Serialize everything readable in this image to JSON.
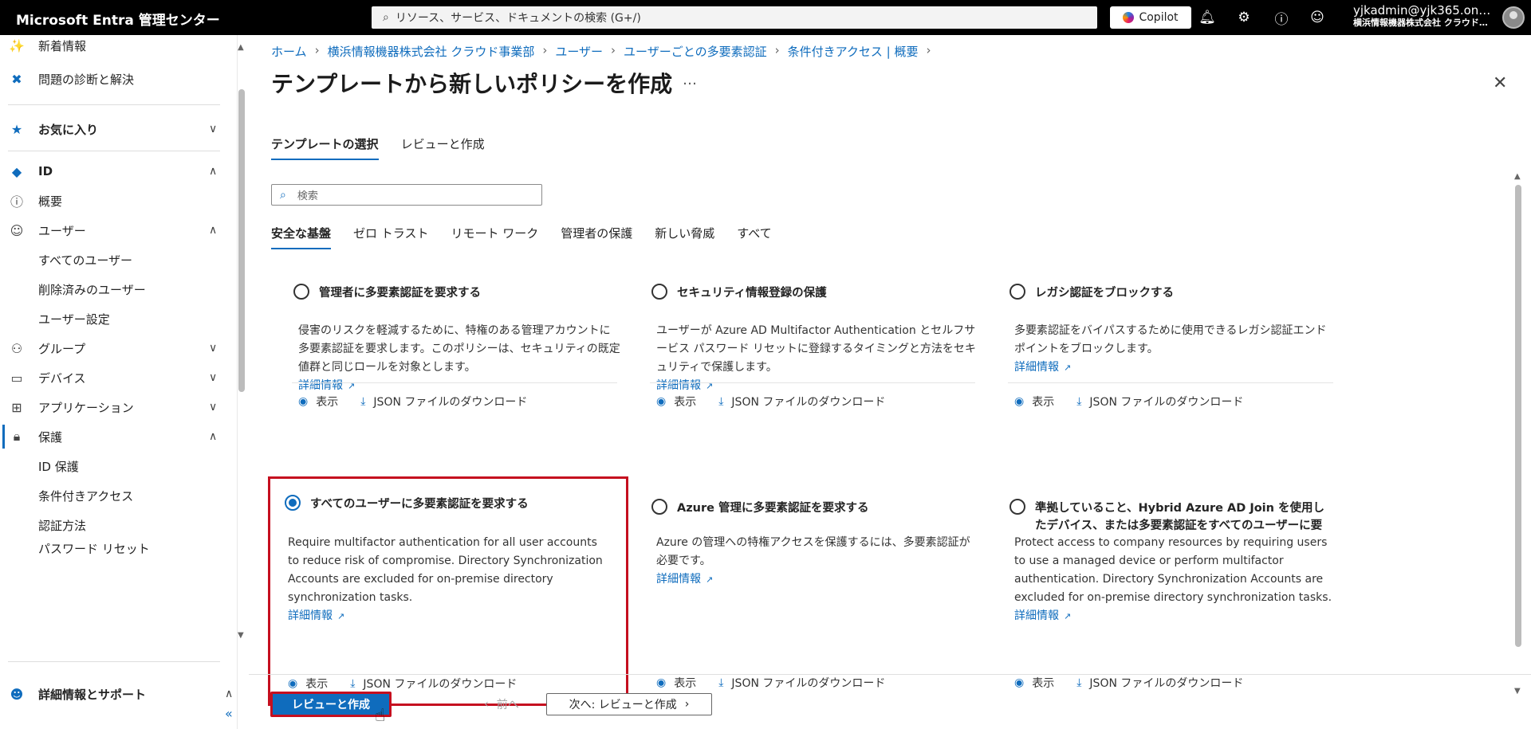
{
  "topbar": {
    "brand": "Microsoft Entra 管理センター",
    "search_placeholder": "リソース、サービス、ドキュメントの検索 (G+/)",
    "copilot_label": "Copilot",
    "user": "yjkadmin@yjk365.on…",
    "org": "横浜情報機器株式会社 クラウド…",
    "icons": [
      "bell-icon",
      "gear-icon",
      "help-icon",
      "feedback-icon"
    ]
  },
  "sidebar": {
    "items": [
      {
        "label": "新着情報",
        "icon": "megaphone"
      },
      {
        "label": "問題の診断と解決",
        "icon": "diagnose"
      },
      {
        "label": "お気に入り",
        "icon": "star"
      },
      {
        "label": "ID",
        "icon": "diamond"
      },
      {
        "label": "概要",
        "icon": "info"
      },
      {
        "label": "ユーザー",
        "icon": "user"
      },
      {
        "label": "すべてのユーザー"
      },
      {
        "label": "削除済みのユーザー"
      },
      {
        "label": "ユーザー設定"
      },
      {
        "label": "グループ",
        "icon": "group"
      },
      {
        "label": "デバイス",
        "icon": "device"
      },
      {
        "label": "アプリケーション",
        "icon": "apps"
      },
      {
        "label": "保護",
        "icon": "lock"
      },
      {
        "label": "ID 保護"
      },
      {
        "label": "条件付きアクセス"
      },
      {
        "label": "認証方法"
      },
      {
        "label": "パスワード リセット"
      },
      {
        "label": "詳細情報とサポート",
        "icon": "person-support"
      }
    ],
    "collapse_label": "«"
  },
  "breadcrumb": [
    "ホーム",
    "横浜情報機器株式会社 クラウド事業部",
    "ユーザー",
    "ユーザーごとの多要素認証",
    "条件付きアクセス | 概要"
  ],
  "page": {
    "title": "テンプレートから新しいポリシーを作成",
    "more": "…"
  },
  "wizard_tabs": [
    {
      "label": "テンプレートの選択",
      "active": true
    },
    {
      "label": "レビューと作成",
      "active": false
    }
  ],
  "search": {
    "placeholder": "検索"
  },
  "category_tabs": [
    {
      "label": "安全な基盤",
      "active": true
    },
    {
      "label": "ゼロ トラスト",
      "active": false
    },
    {
      "label": "リモート ワーク",
      "active": false
    },
    {
      "label": "管理者の保護",
      "active": false
    },
    {
      "label": "新しい脅威",
      "active": false
    },
    {
      "label": "すべて",
      "active": false
    }
  ],
  "cards": [
    {
      "title": "管理者に多要素認証を要求する",
      "desc": "侵害のリスクを軽減するために、特権のある管理アカウントに多要素認証を要求します。このポリシーは、セキュリティの既定値群と同じロールを対象とします。",
      "link": "詳細情報",
      "view": "表示",
      "download": "JSON ファイルのダウンロード",
      "selected": false
    },
    {
      "title": "セキュリティ情報登録の保護",
      "desc": "ユーザーが Azure AD Multifactor Authentication とセルフサービス パスワード リセットに登録するタイミングと方法をセキュリティで保護します。",
      "link": "詳細情報",
      "view": "表示",
      "download": "JSON ファイルのダウンロード",
      "selected": false
    },
    {
      "title": "レガシ認証をブロックする",
      "desc": "多要素認証をバイパスするために使用できるレガシ認証エンドポイントをブロックします。",
      "link": "詳細情報",
      "view": "表示",
      "download": "JSON ファイルのダウンロード",
      "selected": false
    },
    {
      "title": "すべてのユーザーに多要素認証を要求する",
      "desc": "Require multifactor authentication for all user accounts to reduce risk of compromise. Directory Synchronization Accounts are excluded for on-premise directory synchronization tasks.",
      "link": "詳細情報",
      "view": "表示",
      "download": "JSON ファイルのダウンロード",
      "selected": true
    },
    {
      "title": "Azure 管理に多要素認証を要求する",
      "desc": "Azure の管理への特権アクセスを保護するには、多要素認証が必要です。",
      "link": "詳細情報",
      "view": "表示",
      "download": "JSON ファイルのダウンロード",
      "selected": false
    },
    {
      "title": "準拠していること、Hybrid Azure AD Join を使用したデバイス、または多要素認証をすべてのユーザーに要求する",
      "desc": "Protect access to company resources by requiring users to use a managed device or perform multifactor authentication. Directory Synchronization Accounts are excluded for on-premise directory synchronization tasks.",
      "link": "詳細情報",
      "view": "表示",
      "download": "JSON ファイルのダウンロード",
      "selected": false
    }
  ],
  "footer": {
    "primary": "レビューと作成",
    "prev": "前へ",
    "next": "次へ: レビューと作成"
  }
}
